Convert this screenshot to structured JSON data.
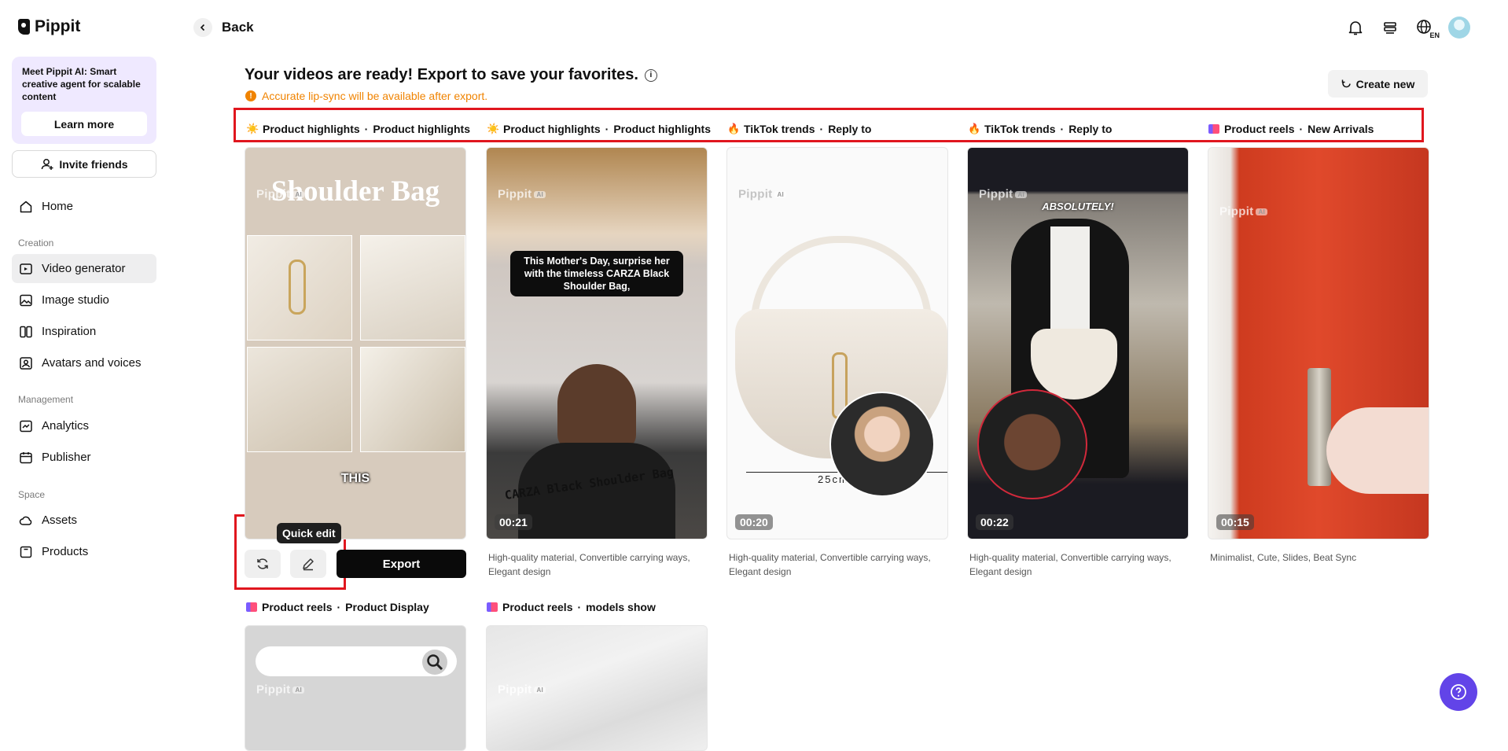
{
  "brand": {
    "name": "Pippit"
  },
  "promo": {
    "text": "Meet Pippit AI: Smart creative agent for scalable content",
    "button": "Learn more"
  },
  "invite": {
    "label": "Invite friends"
  },
  "nav": {
    "home": "Home",
    "creation_label": "Creation",
    "video_generator": "Video generator",
    "image_studio": "Image studio",
    "inspiration": "Inspiration",
    "avatars_voices": "Avatars and voices",
    "management_label": "Management",
    "analytics": "Analytics",
    "publisher": "Publisher",
    "space_label": "Space",
    "assets": "Assets",
    "products": "Products"
  },
  "header": {
    "back": "Back",
    "language": "EN"
  },
  "main": {
    "title": "Your videos are ready! Export to save your favorites.",
    "warning": "Accurate lip-sync will be available after export.",
    "create_new": "Create new"
  },
  "cards": [
    {
      "cat": "Product highlights",
      "sub": "Product highlights",
      "icon": "sun-emoji",
      "overlay_title": "Shoulder Bag",
      "caption": "THIS",
      "desc": ""
    },
    {
      "cat": "Product highlights",
      "sub": "Product highlights",
      "icon": "sun-emoji",
      "caption": "This Mother's Day, surprise her with the timeless CARZA Black Shoulder Bag,",
      "banner": "CARZA Black Shoulder Bag",
      "duration": "00:21",
      "desc": "High-quality material, Convertible carrying ways, Elegant design"
    },
    {
      "cat": "TikTok trends",
      "sub": "Reply to",
      "icon": "fire-emoji",
      "measure": "25cm",
      "duration": "00:20",
      "desc": "High-quality material, Convertible carrying ways, Elegant design"
    },
    {
      "cat": "TikTok trends",
      "sub": "Reply to",
      "icon": "fire-emoji",
      "caption": "ABSOLUTELY!",
      "duration": "00:22",
      "desc": "High-quality material, Convertible carrying ways, Elegant design"
    },
    {
      "cat": "Product reels",
      "sub": "New Arrivals",
      "icon": "reel-icon",
      "duration": "00:15",
      "desc": "Minimalist, Cute, Slides, Beat Sync"
    },
    {
      "cat": "Product reels",
      "sub": "Product Display",
      "icon": "reel-icon"
    },
    {
      "cat": "Product reels",
      "sub": "models show",
      "icon": "reel-icon"
    }
  ],
  "watermark": {
    "name": "Pippit",
    "badge": "AI"
  },
  "quick_edit": {
    "tooltip": "Quick edit",
    "export": "Export"
  },
  "colors": {
    "accent": "#6244e8",
    "warning": "#f08300",
    "highlight_box": "#e0161e"
  }
}
